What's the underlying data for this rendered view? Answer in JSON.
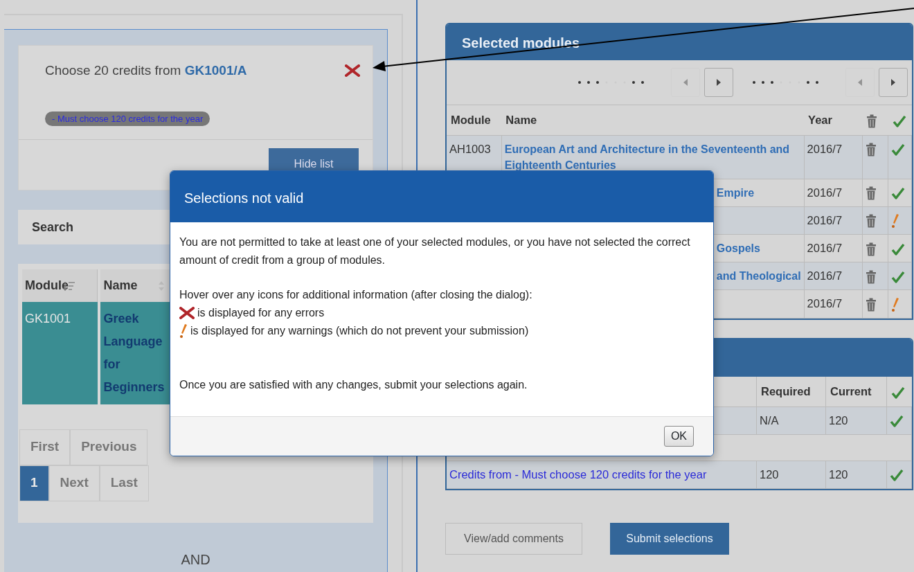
{
  "left_panel": {
    "group": {
      "title_prefix": "Choose 20 credits from",
      "code_link": "GK1001/A",
      "error": true,
      "rule_badge": "- Must choose 120 credits for the year",
      "hide_button": "Hide list"
    },
    "search_label": "Search",
    "table": {
      "columns": [
        "Module",
        "Name"
      ],
      "rows": [
        {
          "module": "GK1001",
          "name": "Greek Language for Beginners",
          "selected": true
        }
      ]
    },
    "pagination": [
      [
        {
          "label": "First",
          "selected": false
        },
        {
          "label": "Previous",
          "selected": false
        }
      ],
      [
        {
          "label": "1",
          "selected": true
        },
        {
          "label": "Next",
          "selected": false
        },
        {
          "label": "Last",
          "selected": false
        }
      ]
    ],
    "connector": "AND"
  },
  "selected_modules": {
    "title": "Selected modules",
    "pagers": [
      {
        "prev_disabled": true,
        "next_disabled": false
      },
      {
        "prev_disabled": true,
        "next_disabled": false
      }
    ],
    "columns": [
      "Module",
      "Name",
      "Year"
    ],
    "rows": [
      {
        "module": "AH1003",
        "name": "European Art and Architecture in the Seventeenth and Eighteenth Centuries",
        "year": "2016/7",
        "warning": false
      },
      {
        "name": "Empire",
        "year": "2016/7",
        "warning": false
      },
      {
        "year": "2016/7",
        "warning": true
      },
      {
        "name": "Gospels",
        "year": "2016/7",
        "warning": false
      },
      {
        "name": "and Theological",
        "year": "2016/7",
        "warning": false
      },
      {
        "year": "2016/7",
        "warning": true
      }
    ]
  },
  "credits": {
    "columns": [
      "Required",
      "Current"
    ],
    "rows": [
      {
        "required": "N/A",
        "current": "120"
      },
      {
        "name": "Credits from - Must choose 120 credits for the year",
        "required": "120",
        "current": "120"
      }
    ]
  },
  "buttons": [
    {
      "label": "View/add comments",
      "kind": "secondary"
    },
    {
      "label": "Submit selections",
      "kind": "primary"
    }
  ],
  "dialog": {
    "title": "Selections not valid",
    "intro": "You are not permitted to take at least one of your selected modules, or you have not selected the correct amount of credit from a group of modules.",
    "hint": "Hover over any icons for additional information (after closing the dialog):",
    "legend": [
      {
        "kind": "error",
        "text": "is displayed for any errors"
      },
      {
        "kind": "warning",
        "text": "is displayed for any warnings (which do not prevent your submission)"
      }
    ],
    "outro": "Once you are satisfied with any changes, submit your selections again.",
    "ok_button": "OK"
  }
}
